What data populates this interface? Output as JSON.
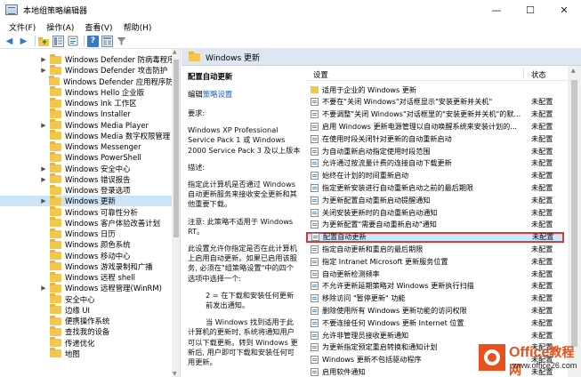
{
  "window": {
    "title": "本地组策略编辑器",
    "minimize": "—",
    "maximize": "☐",
    "close": "✕"
  },
  "menu": [
    "文件(F)",
    "操作(A)",
    "查看(V)",
    "帮助(H)"
  ],
  "toolbar_icons": [
    "back-arrow-icon",
    "forward-arrow-icon",
    "folder-up-icon",
    "show-tree-icon",
    "properties-icon",
    "help-icon",
    "extended-view-icon",
    "filter-icon"
  ],
  "tree": {
    "items": [
      {
        "label": "Windows Defender 防病毒程序",
        "expandable": true
      },
      {
        "label": "Windows Defender 攻击防护",
        "expandable": true
      },
      {
        "label": "Windows Defender 应用程序防护",
        "expandable": false
      },
      {
        "label": "Windows Hello 企业版",
        "expandable": false
      },
      {
        "label": "Windows Ink 工作区",
        "expandable": false
      },
      {
        "label": "Windows Installer",
        "expandable": false
      },
      {
        "label": "Windows Media Player",
        "expandable": true
      },
      {
        "label": "Windows Media 数字权限管理",
        "expandable": false
      },
      {
        "label": "Windows Messenger",
        "expandable": false
      },
      {
        "label": "Windows PowerShell",
        "expandable": false
      },
      {
        "label": "Windows 安全中心",
        "expandable": true
      },
      {
        "label": "Windows 错误报告",
        "expandable": true
      },
      {
        "label": "Windows 登录选项",
        "expandable": false
      },
      {
        "label": "Windows 更新",
        "expandable": true,
        "selected": true
      },
      {
        "label": "Windows 可靠性分析",
        "expandable": false
      },
      {
        "label": "Windows 客户体验改善计划",
        "expandable": false
      },
      {
        "label": "Windows 日历",
        "expandable": false
      },
      {
        "label": "Windows 颜色系统",
        "expandable": false
      },
      {
        "label": "Windows 移动中心",
        "expandable": false
      },
      {
        "label": "Windows 游戏录制和广播",
        "expandable": false
      },
      {
        "label": "Windows 远程 shell",
        "expandable": false
      },
      {
        "label": "Windows 远程管理(WinRM)",
        "expandable": true
      },
      {
        "label": "安全中心",
        "expandable": false
      },
      {
        "label": "边缘 UI",
        "expandable": false
      },
      {
        "label": "便携操作系统",
        "expandable": false
      },
      {
        "label": "查找我的设备",
        "expandable": false
      },
      {
        "label": "传递优化",
        "expandable": false
      },
      {
        "label": "地图",
        "expandable": false
      }
    ]
  },
  "right_header": {
    "title": "Windows 更新"
  },
  "description": {
    "title": "配置自动更新",
    "edit_prefix": "编辑",
    "edit_link": "策略设置",
    "requirements_label": "要求:",
    "requirements": "Windows XP Professional Service Pack 1 或 Windows 2000 Service Pack 3 及以上版本",
    "desc_label": "描述:",
    "desc_text": "指定此计算机是否通过 Windows 自动更新服务来接收安全更新和其他重要下载。",
    "note": "注意: 此策略不适用于 Windows RT。",
    "p1": "此设置允许你指定是否在此计算机上启用自动更新。如果已启用该服务, 必须在\"组策略设置\"中的四个选项中选择一个:",
    "p2": "2 = 在下载和安装任何更新前发出通知。",
    "p3": "当 Windows 找到适用于此计算机的更新时, 系统将通知用户可以下载更新。转到 Windows 更新后, 用户即可下载和安装任何可用更新。"
  },
  "list": {
    "col_setting": "设置",
    "col_state": "状态",
    "rows": [
      {
        "name": "适用于企业的 Windows 更新",
        "state": "",
        "folder": true
      },
      {
        "name": "不要在\"关闭 Windows\"对话框显示\"安装更新并关机\"",
        "state": "未配置"
      },
      {
        "name": "不要调整\"关闭 Windows\"对话框里的\"安装更新并关机\"的默...",
        "state": "未配置"
      },
      {
        "name": "启用 Windows 更新电源管理以自动唤醒系统来安装计划的...",
        "state": "未配置"
      },
      {
        "name": "在使用时段关闭针对更新的自动重新启动",
        "state": "未配置"
      },
      {
        "name": "为自动重新启动指定使用时段范围",
        "state": "未配置"
      },
      {
        "name": "允许通过按流量计费的连接自动下载更新",
        "state": "未配置"
      },
      {
        "name": "始终在计划的时间重新启动",
        "state": "未配置"
      },
      {
        "name": "指定更新安装进行自动重新启动之前的最后期限",
        "state": "未配置"
      },
      {
        "name": "为更新配置自动重新启动提醒通知",
        "state": "未配置"
      },
      {
        "name": "关闭安装更新时的自动重新启动通知",
        "state": "未配置"
      },
      {
        "name": "为更新配置\"需要自动重新启动\"通知",
        "state": "未配置"
      },
      {
        "name": "配置自动更新",
        "state": "未配置",
        "selected": true
      },
      {
        "name": "指定自动更新和重启的最后期限",
        "state": "未配置"
      },
      {
        "name": "指定 Intranet Microsoft 更新服务位置",
        "state": "未配置"
      },
      {
        "name": "自动更新检测频率",
        "state": "未配置"
      },
      {
        "name": "不允许更新延期策略对 Windows 更新执行扫描",
        "state": "未配置"
      },
      {
        "name": "移除访问 \"暂停更新\" 功能",
        "state": "未配置"
      },
      {
        "name": "删除使用所有 Windows 更新功能的访问权限",
        "state": "未配置"
      },
      {
        "name": "不要连接任何 Windows 更新 Internet 位置",
        "state": "未配置"
      },
      {
        "name": "允许非管理员接收更新通知",
        "state": "未配置"
      },
      {
        "name": "为更新指定预定重启转换和通知计划",
        "state": "未配置"
      },
      {
        "name": "Windows 更新不包括驱动程序",
        "state": "未配置"
      },
      {
        "name": "启用软件通知",
        "state": "未配置"
      }
    ]
  },
  "watermark": {
    "brand": "Office",
    "brand_cn": "教程网",
    "url": "www.office26.com"
  }
}
